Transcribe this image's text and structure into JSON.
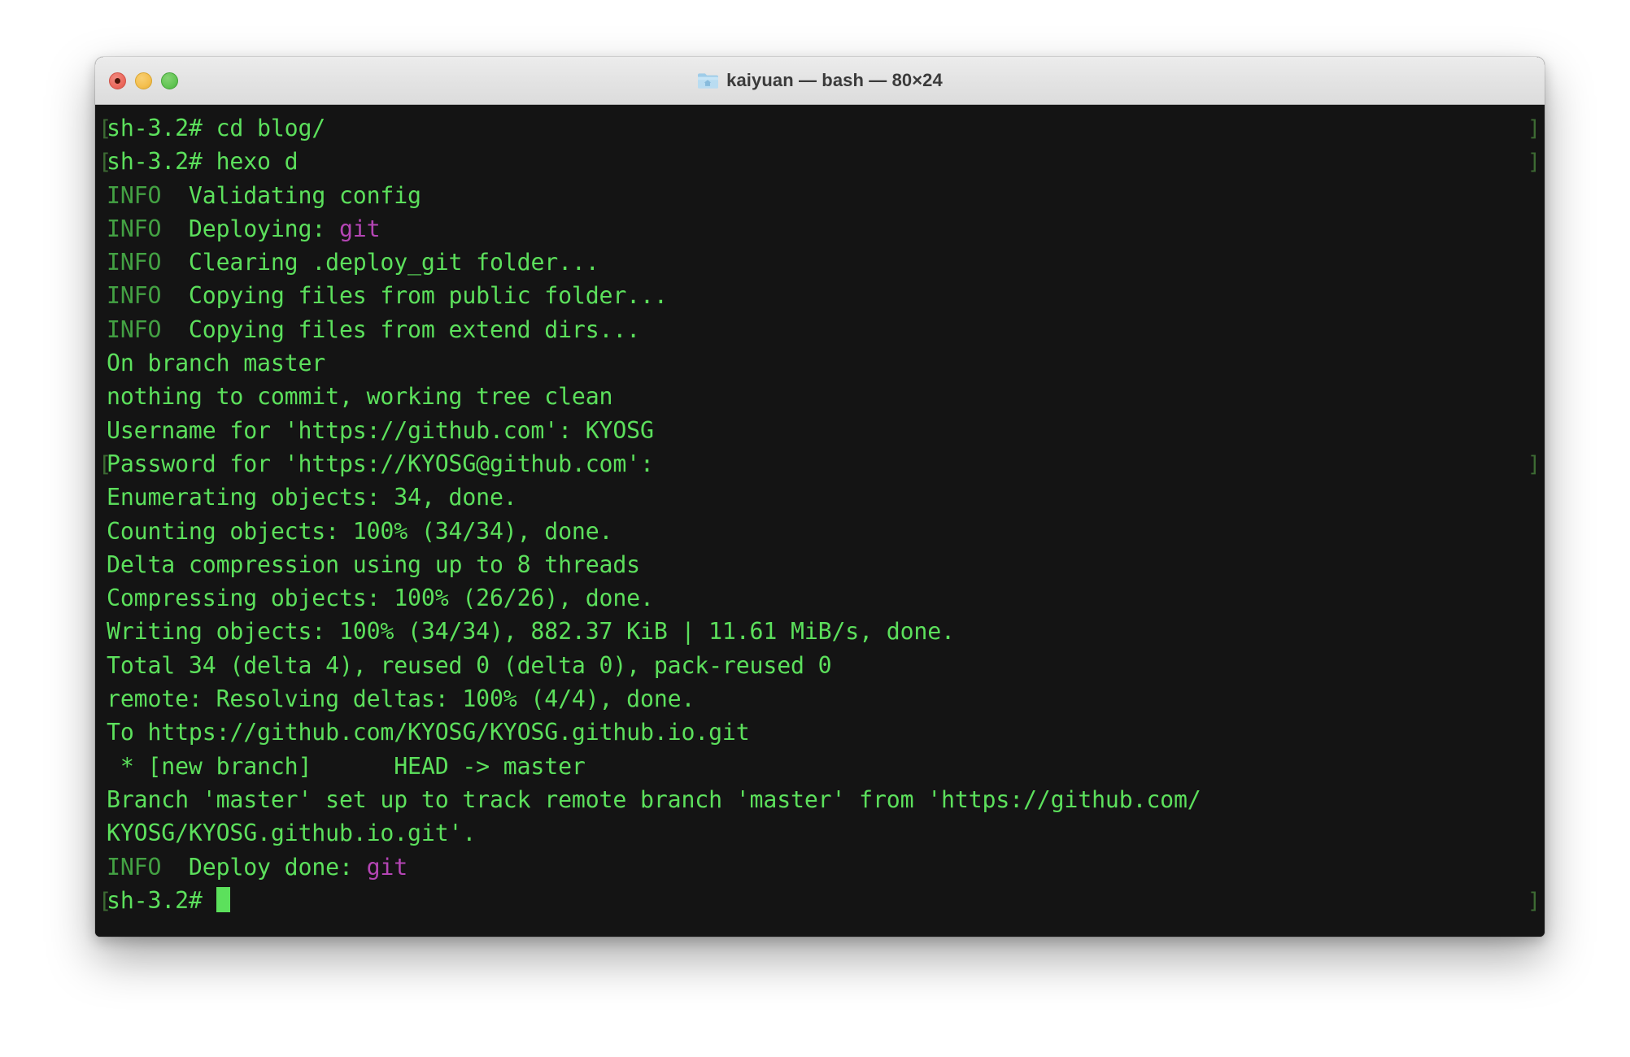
{
  "window": {
    "title": "kaiyuan — bash — 80×24",
    "folder_icon": "home-folder-icon",
    "traffic_lights": {
      "close_label": "Close",
      "minimize_label": "Minimize",
      "maximize_label": "Maximize",
      "close_color": "#ec6a5e",
      "minimize_color": "#f4bf4f",
      "maximize_color": "#62c554"
    }
  },
  "terminal": {
    "colors": {
      "background": "#141414",
      "foreground": "#5ce05c",
      "info": "#43a143",
      "magenta": "#b445b4",
      "mark": "#3d6b33",
      "cursor": "#5ce05c"
    },
    "prompt": "sh-3.2#",
    "cursor": "block",
    "lines": [
      {
        "id": "l1",
        "mark": true,
        "segments": [
          {
            "text": "sh-3.2# cd blog/",
            "color": "bright"
          }
        ]
      },
      {
        "id": "l2",
        "mark": true,
        "segments": [
          {
            "text": "sh-3.2# hexo d",
            "color": "bright"
          }
        ]
      },
      {
        "id": "l3",
        "mark": false,
        "segments": [
          {
            "text": "INFO ",
            "color": "info"
          },
          {
            "text": " Validating config",
            "color": "bright"
          }
        ]
      },
      {
        "id": "l4",
        "mark": false,
        "segments": [
          {
            "text": "INFO ",
            "color": "info"
          },
          {
            "text": " Deploying: ",
            "color": "bright"
          },
          {
            "text": "git",
            "color": "magenta"
          }
        ]
      },
      {
        "id": "l5",
        "mark": false,
        "segments": [
          {
            "text": "INFO ",
            "color": "info"
          },
          {
            "text": " Clearing .deploy_git folder...",
            "color": "bright"
          }
        ]
      },
      {
        "id": "l6",
        "mark": false,
        "segments": [
          {
            "text": "INFO ",
            "color": "info"
          },
          {
            "text": " Copying files from public folder...",
            "color": "bright"
          }
        ]
      },
      {
        "id": "l7",
        "mark": false,
        "segments": [
          {
            "text": "INFO ",
            "color": "info"
          },
          {
            "text": " Copying files from extend dirs...",
            "color": "bright"
          }
        ]
      },
      {
        "id": "l8",
        "mark": false,
        "segments": [
          {
            "text": "On branch master",
            "color": "bright"
          }
        ]
      },
      {
        "id": "l9",
        "mark": false,
        "segments": [
          {
            "text": "nothing to commit, working tree clean",
            "color": "bright"
          }
        ]
      },
      {
        "id": "l10",
        "mark": false,
        "segments": [
          {
            "text": "Username for 'https://github.com': KYOSG",
            "color": "bright"
          }
        ]
      },
      {
        "id": "l11",
        "mark": true,
        "segments": [
          {
            "text": "Password for 'https://KYOSG@github.com': ",
            "color": "bright"
          }
        ]
      },
      {
        "id": "l12",
        "mark": false,
        "segments": [
          {
            "text": "Enumerating objects: 34, done.",
            "color": "bright"
          }
        ]
      },
      {
        "id": "l13",
        "mark": false,
        "segments": [
          {
            "text": "Counting objects: 100% (34/34), done.",
            "color": "bright"
          }
        ]
      },
      {
        "id": "l14",
        "mark": false,
        "segments": [
          {
            "text": "Delta compression using up to 8 threads",
            "color": "bright"
          }
        ]
      },
      {
        "id": "l15",
        "mark": false,
        "segments": [
          {
            "text": "Compressing objects: 100% (26/26), done.",
            "color": "bright"
          }
        ]
      },
      {
        "id": "l16",
        "mark": false,
        "segments": [
          {
            "text": "Writing objects: 100% (34/34), 882.37 KiB | 11.61 MiB/s, done.",
            "color": "bright"
          }
        ]
      },
      {
        "id": "l17",
        "mark": false,
        "segments": [
          {
            "text": "Total 34 (delta 4), reused 0 (delta 0), pack-reused 0",
            "color": "bright"
          }
        ]
      },
      {
        "id": "l18",
        "mark": false,
        "segments": [
          {
            "text": "remote: Resolving deltas: 100% (4/4), done.",
            "color": "bright"
          }
        ]
      },
      {
        "id": "l19",
        "mark": false,
        "segments": [
          {
            "text": "To https://github.com/KYOSG/KYOSG.github.io.git",
            "color": "bright"
          }
        ]
      },
      {
        "id": "l20",
        "mark": false,
        "segments": [
          {
            "text": " * [new branch]      HEAD -> master",
            "color": "bright"
          }
        ]
      },
      {
        "id": "l21",
        "mark": false,
        "segments": [
          {
            "text": "Branch 'master' set up to track remote branch 'master' from 'https://github.com/",
            "color": "bright"
          }
        ]
      },
      {
        "id": "l22",
        "mark": false,
        "segments": [
          {
            "text": "KYOSG/KYOSG.github.io.git'.",
            "color": "bright"
          }
        ]
      },
      {
        "id": "l23",
        "mark": false,
        "segments": [
          {
            "text": "INFO ",
            "color": "info"
          },
          {
            "text": " Deploy done: ",
            "color": "bright"
          },
          {
            "text": "git",
            "color": "magenta"
          }
        ]
      },
      {
        "id": "l24",
        "mark": true,
        "cursor": true,
        "segments": [
          {
            "text": "sh-3.2# ",
            "color": "bright"
          }
        ]
      }
    ],
    "mark_left": "[",
    "mark_right": "]"
  }
}
